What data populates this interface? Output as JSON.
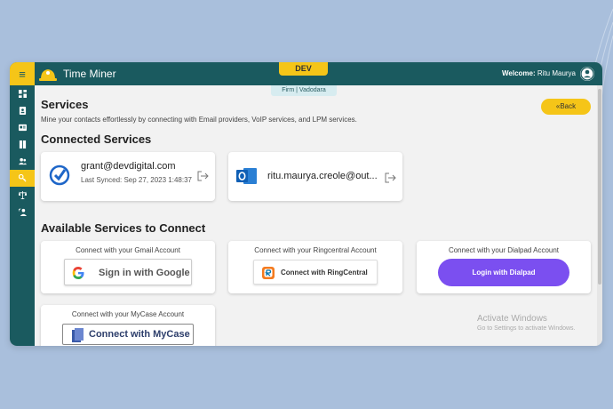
{
  "app": {
    "title": "Time Miner",
    "env": "DEV",
    "welcome_label": "Welcome:",
    "user_name": "Ritu Maurya",
    "firm": "Firm | Vadodara"
  },
  "sidebar": {
    "items": [
      {
        "icon": "dashboard-icon",
        "active": false
      },
      {
        "icon": "contact-card-icon",
        "active": false
      },
      {
        "icon": "id-card-icon",
        "active": false
      },
      {
        "icon": "book-icon",
        "active": false
      },
      {
        "icon": "users-icon",
        "active": false
      },
      {
        "icon": "key-icon",
        "active": true
      },
      {
        "icon": "scale-icon",
        "active": false
      },
      {
        "icon": "user-support-icon",
        "active": false
      }
    ]
  },
  "page": {
    "title": "Services",
    "subtitle": "Mine your contacts effortlessly by connecting with Email providers, VoIP services, and LPM services.",
    "back_label": "«Back"
  },
  "connected": {
    "title": "Connected Services",
    "items": [
      {
        "email": "grant@devdigital.com",
        "sync": "Last Synced: Sep 27, 2023 1:48:37",
        "icon": "todo-check-icon"
      },
      {
        "email": "ritu.maurya.creole@out...",
        "sync": "",
        "icon": "outlook-icon"
      }
    ]
  },
  "available": {
    "title": "Available Services to Connect",
    "gmail": {
      "label": "Connect with your Gmail Account",
      "button": "Sign in with Google"
    },
    "ringcentral": {
      "label": "Connect with your Ringcentral Account",
      "button": "Connect with RingCentral"
    },
    "dialpad": {
      "label": "Connect with your Dialpad Account",
      "button": "Login with Dialpad"
    },
    "mycase": {
      "label": "Connect with your MyCase Account",
      "button": "Connect with MyCase"
    }
  },
  "watermark": {
    "title": "Activate Windows",
    "subtitle": "Go to Settings to activate Windows."
  },
  "colors": {
    "topbar": "#1a5a5f",
    "accent": "#f5c518",
    "dialpad": "#7b4ff0",
    "background": "#a9bfdc"
  }
}
